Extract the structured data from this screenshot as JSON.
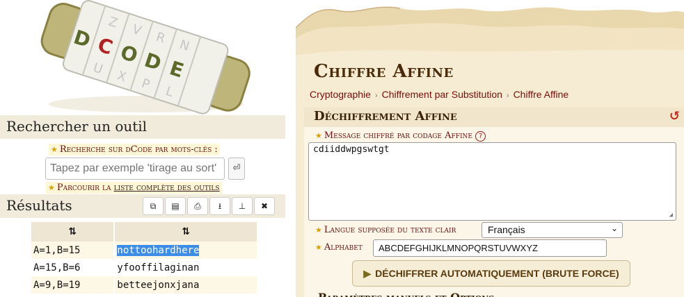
{
  "left": {
    "search_heading": "Rechercher un outil",
    "search_label": "Recherche sur dCode par mots-clés :",
    "search_placeholder": "Tapez par exemple 'tirage au sort'",
    "search_go_icon": "⏎",
    "browse_prefix": "Parcourir la ",
    "browse_link": "liste complète des outils",
    "results_heading": "Résultats",
    "tools": [
      {
        "name": "copy-icon",
        "glyph": "⧉"
      },
      {
        "name": "clipboard-icon",
        "glyph": "▤"
      },
      {
        "name": "print-icon",
        "glyph": "⎙"
      },
      {
        "name": "download-icon",
        "glyph": "⭳"
      },
      {
        "name": "pin-icon",
        "glyph": "⊥"
      },
      {
        "name": "close-icon",
        "glyph": "✖"
      }
    ],
    "results_table": {
      "headers": [
        "⇅",
        "⇅"
      ],
      "rows": [
        [
          "A=1,B=15",
          "nottoohardhere"
        ],
        [
          "A=15,B=6",
          "yfooffilaginan"
        ],
        [
          "A=9,B=19",
          "betteejonxjana"
        ]
      ]
    }
  },
  "right": {
    "page_title": "Chiffre Affine",
    "breadcrumb": [
      "Cryptographie",
      "Chiffrement par Substitution",
      "Chiffre Affine"
    ],
    "panel_title": "Déchiffrement Affine",
    "reset_icon": "↺",
    "message_label": "Message chiffré par codage Affine",
    "help_icon": "?",
    "message_value": "cdiiddwpgswtgt",
    "language_label": "Langue supposée du texte clair",
    "language_value": "Français",
    "alphabet_label": "Alphabet",
    "alphabet_value": "ABCDEFGHIJKLMNOPQRSTUVWXYZ",
    "brute_button": "DÉCHIFFRER AUTOMATIQUEMENT (BRUTE FORCE)",
    "next_section": "Paramètres manuels et Options"
  },
  "colors": {
    "accent": "#7a0c0c",
    "title": "#4a2a07",
    "highlight": "#3b8de8",
    "parchment": "#f6ecd3"
  }
}
